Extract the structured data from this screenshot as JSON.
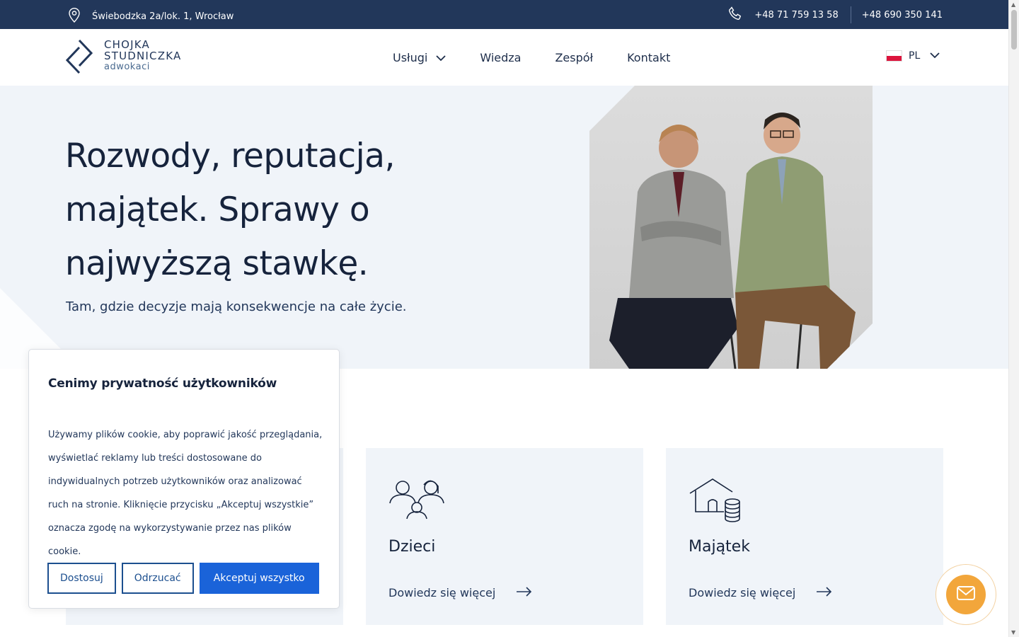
{
  "topbar": {
    "address": "Świebodzka 2a/lok. 1, Wrocław",
    "phone1": "+48 71 759 13 58",
    "phone2": "+48 690 350 141"
  },
  "logo": {
    "line1": "CHOJKA",
    "line2": "STUDNICZKA",
    "line3": "adwokaci"
  },
  "nav": {
    "items": [
      {
        "label": "Usługi"
      },
      {
        "label": "Wiedza"
      },
      {
        "label": "Zespół"
      },
      {
        "label": "Kontakt"
      }
    ]
  },
  "language": {
    "code": "PL"
  },
  "hero": {
    "title_line1": "Rozwody, reputacja,",
    "title_line2": "majątek. Sprawy o",
    "title_line3": "najwyższą stawkę.",
    "subtitle": "Tam, gdzie decyzje mają konsekwencje na całe życie."
  },
  "cards": [
    {
      "title": "Dzieci",
      "link": "Dowiedz się więcej",
      "icon": "family-icon"
    },
    {
      "title": "Majątek",
      "link": "Dowiedz się więcej",
      "icon": "house-coins-icon"
    }
  ],
  "cookie": {
    "title": "Cenimy prywatność użytkowników",
    "body": "Używamy plików cookie, aby poprawić jakość przeglądania, wyświetlać reklamy lub treści dostosowane do indywidualnych potrzeb użytkowników oraz analizować ruch na stronie. Kliknięcie przycisku „Akceptuj wszystkie” oznacza zgodę na wykorzystywanie przez nas plików cookie.",
    "btn_customize": "Dostosuj",
    "btn_reject": "Odrzucać",
    "btn_accept": "Akceptuj wszystko"
  },
  "colors": {
    "topbar_bg": "#22375a",
    "hero_bg": "#f0f4f9",
    "accent_blue": "#1a63d9",
    "fab_orange": "#f2a63b"
  }
}
